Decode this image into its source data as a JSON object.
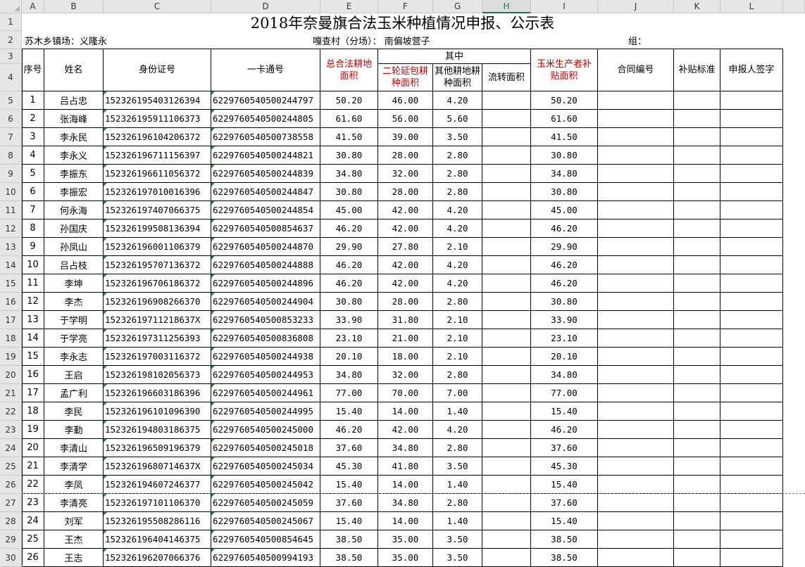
{
  "columns": [
    "A",
    "B",
    "C",
    "D",
    "E",
    "F",
    "G",
    "H",
    "I",
    "J",
    "K",
    "L"
  ],
  "active_column": "H",
  "row_numbers": [
    1,
    2,
    3,
    4,
    5,
    6,
    7,
    8,
    9,
    10,
    11,
    12,
    13,
    14,
    15,
    16,
    17,
    18,
    19,
    20,
    21,
    22,
    23,
    24,
    25,
    26,
    27,
    28,
    29,
    30
  ],
  "title": "2018年奈曼旗合法玉米种植情况申报、公示表",
  "info": {
    "township": "苏木乡镇场：义隆永",
    "village": "嘎查村（分场）：  南偏坡营子",
    "group": "组："
  },
  "headers": {
    "seq": "序号",
    "name": "姓名",
    "id_number": "身份证号",
    "card_number": "一卡通号",
    "total_area": "总合法耕地面积",
    "of_which": "其中",
    "second_round": "二轮延包耕种面积",
    "other_land": "其他耕地耕种面积",
    "transfer_area": "流转面积",
    "subsidy_area": "玉米生产者补贴面积",
    "contract_no": "合同编号",
    "subsidy_std": "补贴标准",
    "signature": "申报人签字"
  },
  "rows": [
    {
      "seq": "1",
      "name": "吕占忠",
      "id": "152326195403126394",
      "card": "6229760540500244797",
      "total": "50.20",
      "second": "46.00",
      "other": "4.20",
      "transfer": "",
      "subsidy": "50.20"
    },
    {
      "seq": "2",
      "name": "张海峰",
      "id": "152326195911106373",
      "card": "6229760540500244805",
      "total": "61.60",
      "second": "56.00",
      "other": "5.60",
      "transfer": "",
      "subsidy": "61.60"
    },
    {
      "seq": "3",
      "name": "李永民",
      "id": "152326196104206372",
      "card": "6229760540500738558",
      "total": "41.50",
      "second": "39.00",
      "other": "3.50",
      "transfer": "",
      "subsidy": "41.50"
    },
    {
      "seq": "4",
      "name": "李永义",
      "id": "152326196711156397",
      "card": "6229760540500244821",
      "total": "30.80",
      "second": "28.00",
      "other": "2.80",
      "transfer": "",
      "subsidy": "30.80"
    },
    {
      "seq": "5",
      "name": "李振东",
      "id": "152326196611056372",
      "card": "6229760540500244839",
      "total": "34.80",
      "second": "32.00",
      "other": "2.80",
      "transfer": "",
      "subsidy": "34.80"
    },
    {
      "seq": "6",
      "name": "李振宏",
      "id": "152326197010016396",
      "card": "6229760540500244847",
      "total": "30.80",
      "second": "28.00",
      "other": "2.80",
      "transfer": "",
      "subsidy": "30.80"
    },
    {
      "seq": "7",
      "name": "何永海",
      "id": "152326197407066375",
      "card": "6229760540500244854",
      "total": "45.00",
      "second": "42.00",
      "other": "4.20",
      "transfer": "",
      "subsidy": "45.00"
    },
    {
      "seq": "8",
      "name": "孙国庆",
      "id": "152326199508136394",
      "card": "6229760540500854637",
      "total": "46.20",
      "second": "42.00",
      "other": "4.20",
      "transfer": "",
      "subsidy": "46.20"
    },
    {
      "seq": "9",
      "name": "孙凤山",
      "id": "152326196001106379",
      "card": "6229760540500244870",
      "total": "29.90",
      "second": "27.80",
      "other": "2.10",
      "transfer": "",
      "subsidy": "29.90"
    },
    {
      "seq": "10",
      "name": "吕占枝",
      "id": "152326195707136372",
      "card": "6229760540500244888",
      "total": "46.20",
      "second": "42.00",
      "other": "4.20",
      "transfer": "",
      "subsidy": "46.20"
    },
    {
      "seq": "11",
      "name": "李坤",
      "id": "152326196706186372",
      "card": "6229760540500244896",
      "total": "46.20",
      "second": "42.00",
      "other": "4.20",
      "transfer": "",
      "subsidy": "46.20"
    },
    {
      "seq": "12",
      "name": "李杰",
      "id": "152326196908266370",
      "card": "6229760540500244904",
      "total": "30.80",
      "second": "28.00",
      "other": "2.80",
      "transfer": "",
      "subsidy": "30.80"
    },
    {
      "seq": "13",
      "name": "于学明",
      "id": "15232619711218637X",
      "card": "6229760540500853233",
      "total": "33.90",
      "second": "31.80",
      "other": "2.10",
      "transfer": "",
      "subsidy": "33.90"
    },
    {
      "seq": "14",
      "name": "于学亮",
      "id": "152326197311256393",
      "card": "6229760540500836808",
      "total": "23.10",
      "second": "21.00",
      "other": "2.10",
      "transfer": "",
      "subsidy": "23.10"
    },
    {
      "seq": "15",
      "name": "李永志",
      "id": "152326197003116372",
      "card": "6229760540500244938",
      "total": "20.10",
      "second": "18.00",
      "other": "2.10",
      "transfer": "",
      "subsidy": "20.10"
    },
    {
      "seq": "16",
      "name": "王启",
      "id": "152326198102056373",
      "card": "6229760540500244953",
      "total": "34.80",
      "second": "32.00",
      "other": "2.80",
      "transfer": "",
      "subsidy": "34.80"
    },
    {
      "seq": "17",
      "name": "孟广利",
      "id": "152326196603186396",
      "card": "6229760540500244961",
      "total": "77.00",
      "second": "70.00",
      "other": "7.00",
      "transfer": "",
      "subsidy": "77.00"
    },
    {
      "seq": "18",
      "name": "李民",
      "id": "152326196101096390",
      "card": "6229760540500244995",
      "total": "15.40",
      "second": "14.00",
      "other": "1.40",
      "transfer": "",
      "subsidy": "15.40"
    },
    {
      "seq": "19",
      "name": "李勤",
      "id": "152326194803186375",
      "card": "6229760540500245000",
      "total": "46.20",
      "second": "42.00",
      "other": "4.20",
      "transfer": "",
      "subsidy": "46.20"
    },
    {
      "seq": "20",
      "name": "李清山",
      "id": "152326196509196379",
      "card": "6229760540500245018",
      "total": "37.60",
      "second": "34.80",
      "other": "2.80",
      "transfer": "",
      "subsidy": "37.60"
    },
    {
      "seq": "21",
      "name": "李清学",
      "id": "15232619680714637X",
      "card": "6229760540500245034",
      "total": "45.30",
      "second": "41.80",
      "other": "3.50",
      "transfer": "",
      "subsidy": "45.30"
    },
    {
      "seq": "22",
      "name": "李凤",
      "id": "152326194607246377",
      "card": "6229760540500245042",
      "total": "15.40",
      "second": "14.00",
      "other": "1.40",
      "transfer": "",
      "subsidy": "15.40"
    },
    {
      "seq": "23",
      "name": "李清亮",
      "id": "152326197101106370",
      "card": "6229760540500245059",
      "total": "37.60",
      "second": "34.80",
      "other": "2.80",
      "transfer": "",
      "subsidy": "37.60"
    },
    {
      "seq": "24",
      "name": "刘军",
      "id": "152326195508286116",
      "card": "6229760540500245067",
      "total": "15.40",
      "second": "14.00",
      "other": "1.40",
      "transfer": "",
      "subsidy": "15.40"
    },
    {
      "seq": "25",
      "name": "王杰",
      "id": "152326196404146375",
      "card": "6229760540500854645",
      "total": "38.50",
      "second": "35.00",
      "other": "3.50",
      "transfer": "",
      "subsidy": "38.50"
    },
    {
      "seq": "26",
      "name": "王志",
      "id": "152326196207066376",
      "card": "6229760540500994193",
      "total": "38.50",
      "second": "35.00",
      "other": "3.50",
      "transfer": "",
      "subsidy": "38.50"
    }
  ]
}
